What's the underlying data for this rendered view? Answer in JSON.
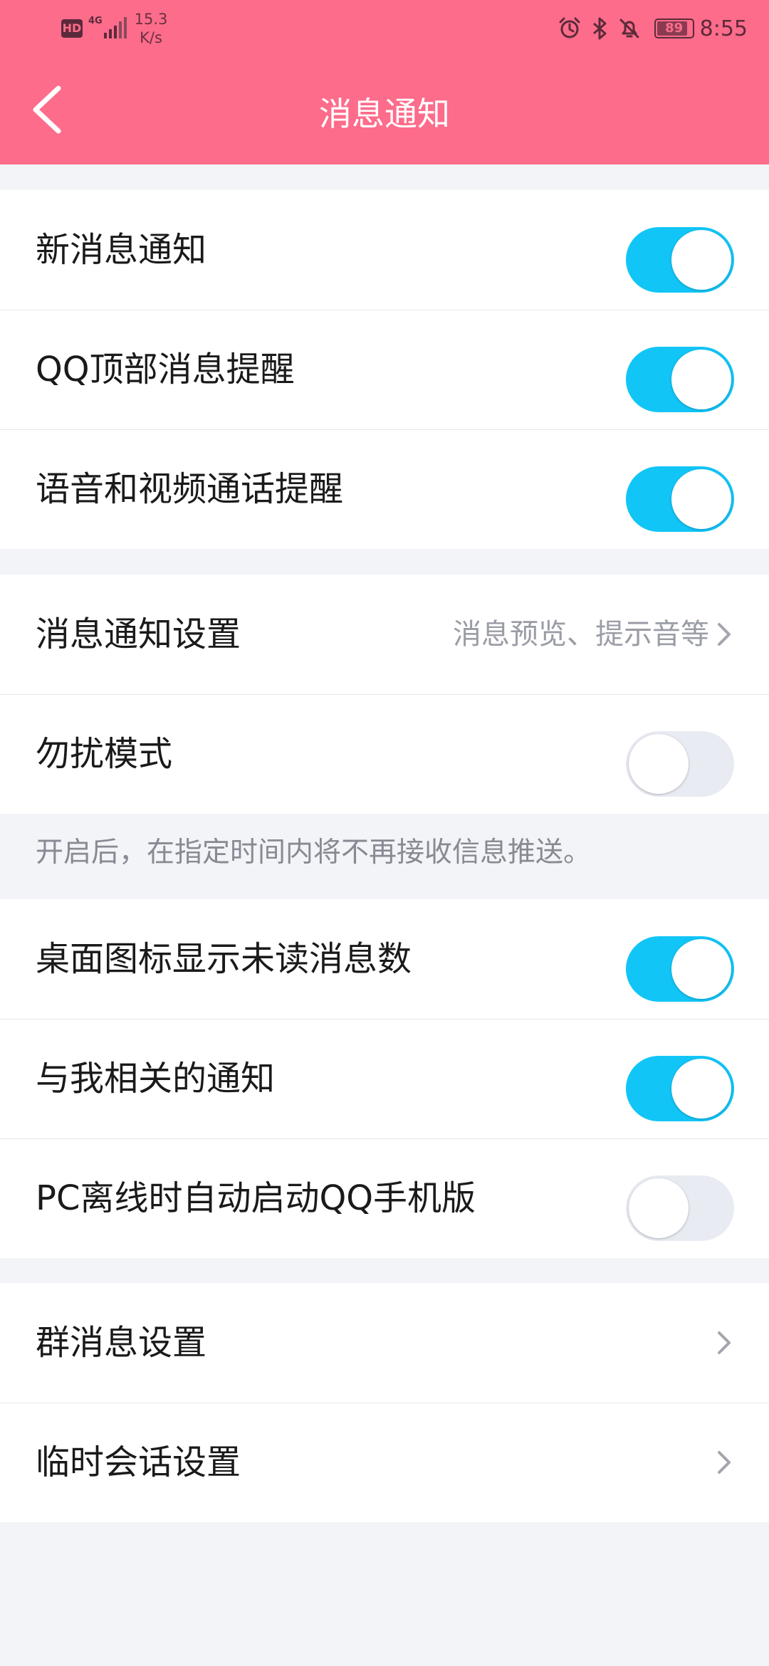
{
  "status_bar": {
    "hd_badge": "HD",
    "network": "4G",
    "speed_value": "15.3",
    "speed_unit": "K/s",
    "battery": "89",
    "time": "8:55",
    "icons": [
      "alarm-icon",
      "bluetooth-icon",
      "mute-bell-icon"
    ]
  },
  "header": {
    "title": "消息通知",
    "back_icon": "chevron-left-icon"
  },
  "group1": [
    {
      "label": "新消息通知",
      "toggle": "on"
    },
    {
      "label": "QQ顶部消息提醒",
      "toggle": "on"
    },
    {
      "label": "语音和视频通话提醒",
      "toggle": "on"
    }
  ],
  "group2": {
    "notification_settings": {
      "label": "消息通知设置",
      "value": "消息预览、提示音等"
    },
    "dnd": {
      "label": "勿扰模式",
      "toggle": "off"
    },
    "note": "开启后，在指定时间内将不再接收信息推送。"
  },
  "group3": [
    {
      "label": "桌面图标显示未读消息数",
      "toggle": "on"
    },
    {
      "label": "与我相关的通知",
      "toggle": "on"
    },
    {
      "label": "PC离线时自动启动QQ手机版",
      "toggle": "off"
    }
  ],
  "group4": [
    {
      "label": "群消息设置"
    },
    {
      "label": "临时会话设置"
    }
  ],
  "colors": {
    "header": "#fd6c8b",
    "toggle_on": "#12c5f7",
    "toggle_off": "#e9ebf3",
    "background": "#f3f4f8"
  }
}
